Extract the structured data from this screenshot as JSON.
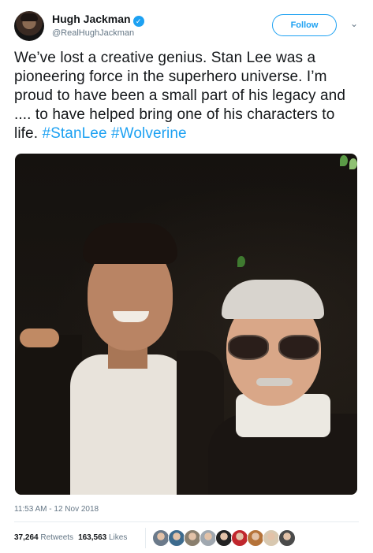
{
  "author": {
    "name": "Hugh Jackman",
    "verified_mark": "✓",
    "handle": "@RealHughJackman"
  },
  "follow_button": {
    "label": "Follow"
  },
  "menu_caret": {
    "glyph": "⌄",
    "icon": "chevron-down-icon"
  },
  "tweet": {
    "text_before": "We’ve lost a creative genius. Stan Lee was a pioneering force in the superhero universe. I’m proud to have been a small part of his legacy and .... to have helped bring one of his characters to life. ",
    "hashtags": [
      "#StanLee",
      "#Wolverine"
    ]
  },
  "photo": {
    "description_icon": "photo"
  },
  "timestamp": "11:53 AM - 12 Nov 2018",
  "stats": {
    "retweets_count": "37,264",
    "retweets_label": "Retweets",
    "likes_count": "163,563",
    "likes_label": "Likes"
  },
  "likers": {
    "colors": [
      "#6b7a8a",
      "#3d6b8e",
      "#8a7f6e",
      "#a0a8b0",
      "#222222",
      "#c0272d",
      "#b5733a",
      "#d8c8b0",
      "#4a4a4a"
    ]
  },
  "colors": {
    "accent": "#1da1f2",
    "text": "#14171a",
    "muted": "#657786"
  }
}
